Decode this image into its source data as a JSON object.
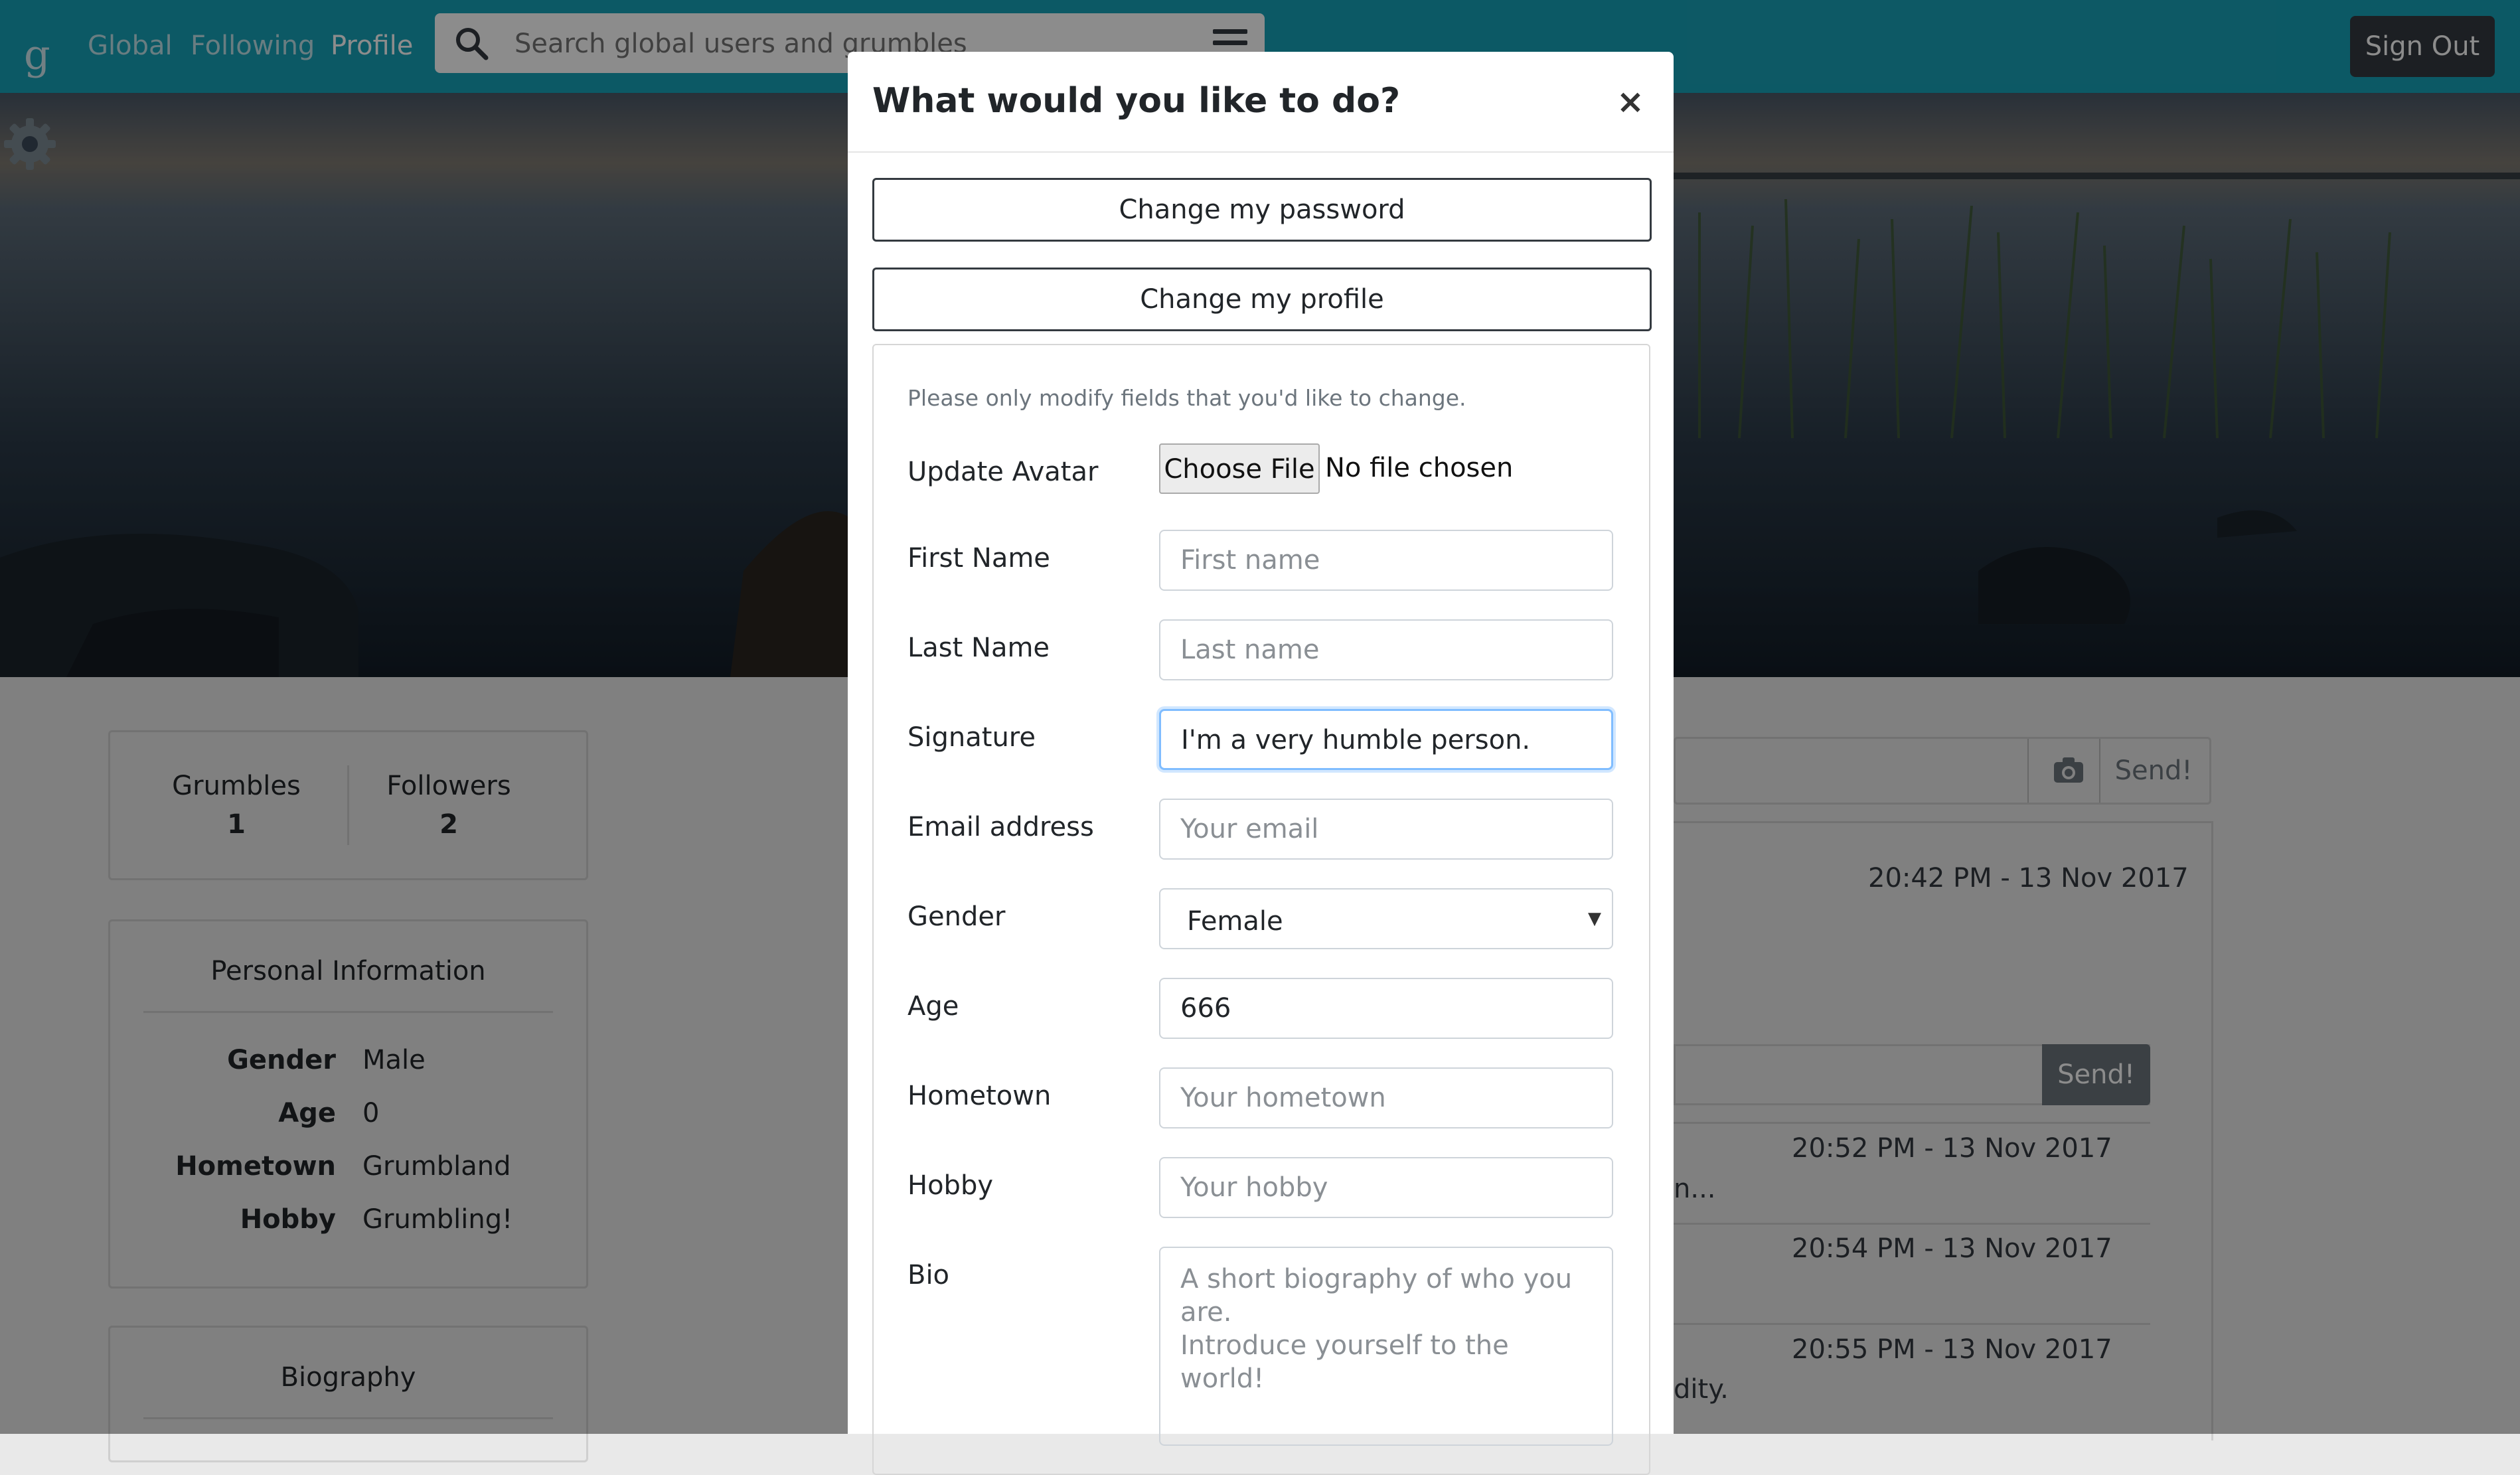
{
  "navbar": {
    "logo": "g",
    "links": [
      "Global",
      "Following",
      "Profile"
    ],
    "active_link": "Profile",
    "search_placeholder": "Search global users and grumbles",
    "sign_out": "Sign Out"
  },
  "profile": {
    "stats": [
      {
        "label": "Grumbles",
        "value": "1"
      },
      {
        "label": "Followers",
        "value": "2"
      }
    ],
    "personal_info": {
      "title": "Personal Information",
      "rows": [
        {
          "key": "Gender",
          "value": "Male"
        },
        {
          "key": "Age",
          "value": "0"
        },
        {
          "key": "Hometown",
          "value": "Grumbland"
        },
        {
          "key": "Hobby",
          "value": "Grumbling!"
        }
      ]
    },
    "biography_title": "Biography"
  },
  "feed": {
    "send_label": "Send!",
    "send_label_2": "Send!",
    "timestamps": [
      "20:42 PM - 13 Nov 2017",
      "20:52 PM - 13 Nov 2017",
      "20:54 PM - 13 Nov 2017",
      "20:55 PM - 13 Nov 2017"
    ],
    "snippets": [
      "n...",
      "dity."
    ]
  },
  "modal": {
    "title": "What would you like to do?",
    "close": "×",
    "change_password": "Change my password",
    "change_profile": "Change my profile",
    "hint": "Please only modify fields that you'd like to change.",
    "fields": {
      "avatar": {
        "label": "Update Avatar",
        "button": "Choose File",
        "status": "No file chosen"
      },
      "first_name": {
        "label": "First Name",
        "placeholder": "First name"
      },
      "last_name": {
        "label": "Last Name",
        "placeholder": "Last name"
      },
      "signature": {
        "label": "Signature",
        "value": "I'm a very humble person."
      },
      "email": {
        "label": "Email address",
        "placeholder": "Your email"
      },
      "gender": {
        "label": "Gender",
        "value": "Female"
      },
      "age": {
        "label": "Age",
        "value": "666"
      },
      "hometown": {
        "label": "Hometown",
        "placeholder": "Your hometown"
      },
      "hobby": {
        "label": "Hobby",
        "placeholder": "Your hobby"
      },
      "bio": {
        "label": "Bio",
        "placeholder": "A short biography of who you are.\nIntroduce yourself to the world!"
      }
    }
  },
  "colors": {
    "navbar": "#17a2b8",
    "dark": "#343a40",
    "focus": "#80bdff"
  }
}
